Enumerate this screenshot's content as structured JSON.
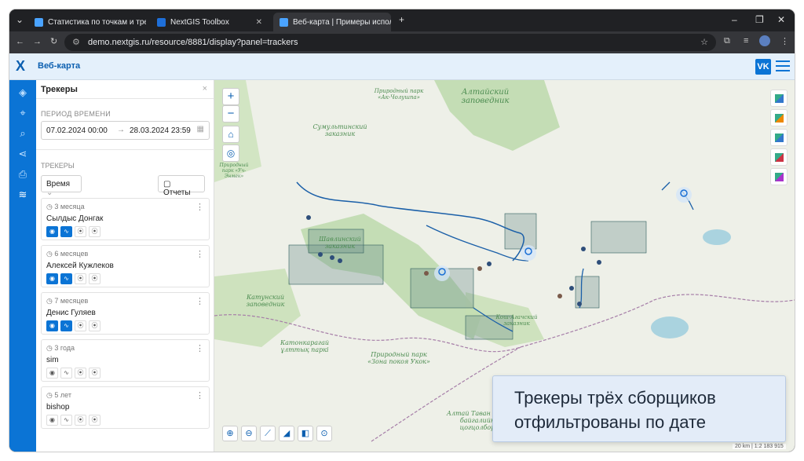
{
  "browser": {
    "tabs": [
      {
        "label": "Статистика по точкам и трека",
        "color": "#4aa3ff"
      },
      {
        "label": "NextGIS Toolbox",
        "color": "#4aa3ff"
      },
      {
        "label": "Веб-карта | Примеры исполь",
        "color": "#4aa3ff"
      }
    ],
    "url": "demo.nextgis.ru/resource/8881/display?panel=trackers"
  },
  "app": {
    "logo": "X",
    "title": "Веб-карта",
    "vk": "VK"
  },
  "panel": {
    "title": "Трекеры",
    "period_label": "ПЕРИОД ВРЕМЕНИ",
    "date_from": "07.02.2024 00:00",
    "date_to": "28.03.2024 23:59",
    "trackers_label": "ТРЕКЕРЫ",
    "time_select": "Время",
    "reports_button": "Отчеты",
    "trackers": [
      {
        "age": "3 месяца",
        "name": "Сылдыс Донгак",
        "active": true
      },
      {
        "age": "6 месяцев",
        "name": "Алексей Кужлеков",
        "active": true
      },
      {
        "age": "7 месяцев",
        "name": "Денис Гуляев",
        "active": true
      },
      {
        "age": "3 года",
        "name": "sim",
        "active": false
      },
      {
        "age": "5 лет",
        "name": "bishop",
        "active": false
      }
    ]
  },
  "map": {
    "labels": [
      {
        "text": "Алтайский заповедник"
      },
      {
        "text": "Сумультинский заказник"
      },
      {
        "text": "Природный парк «Ак-Чолушпа»"
      },
      {
        "text": "Шавлинский заказник"
      },
      {
        "text": "Катунский заповедник"
      },
      {
        "text": "Катонкарагай ұлттық паркі"
      },
      {
        "text": "Природный парк «Зона покоя Укок»"
      },
      {
        "text": "Кош-Агачский заказник"
      },
      {
        "text": "Алтай Таван Богд байгалийн цогцолбор"
      },
      {
        "text": "Природный парк «Уч-Энмек»"
      }
    ],
    "scale": "20 km | 1:2 183 915"
  },
  "caption": {
    "line1": "Трекеры трёх сборщиков",
    "line2": "отфильтрованы по дате"
  },
  "colors": {
    "accent": "#0b74d5",
    "track": "#1a5fa8",
    "grid": "#2f5e5e"
  }
}
